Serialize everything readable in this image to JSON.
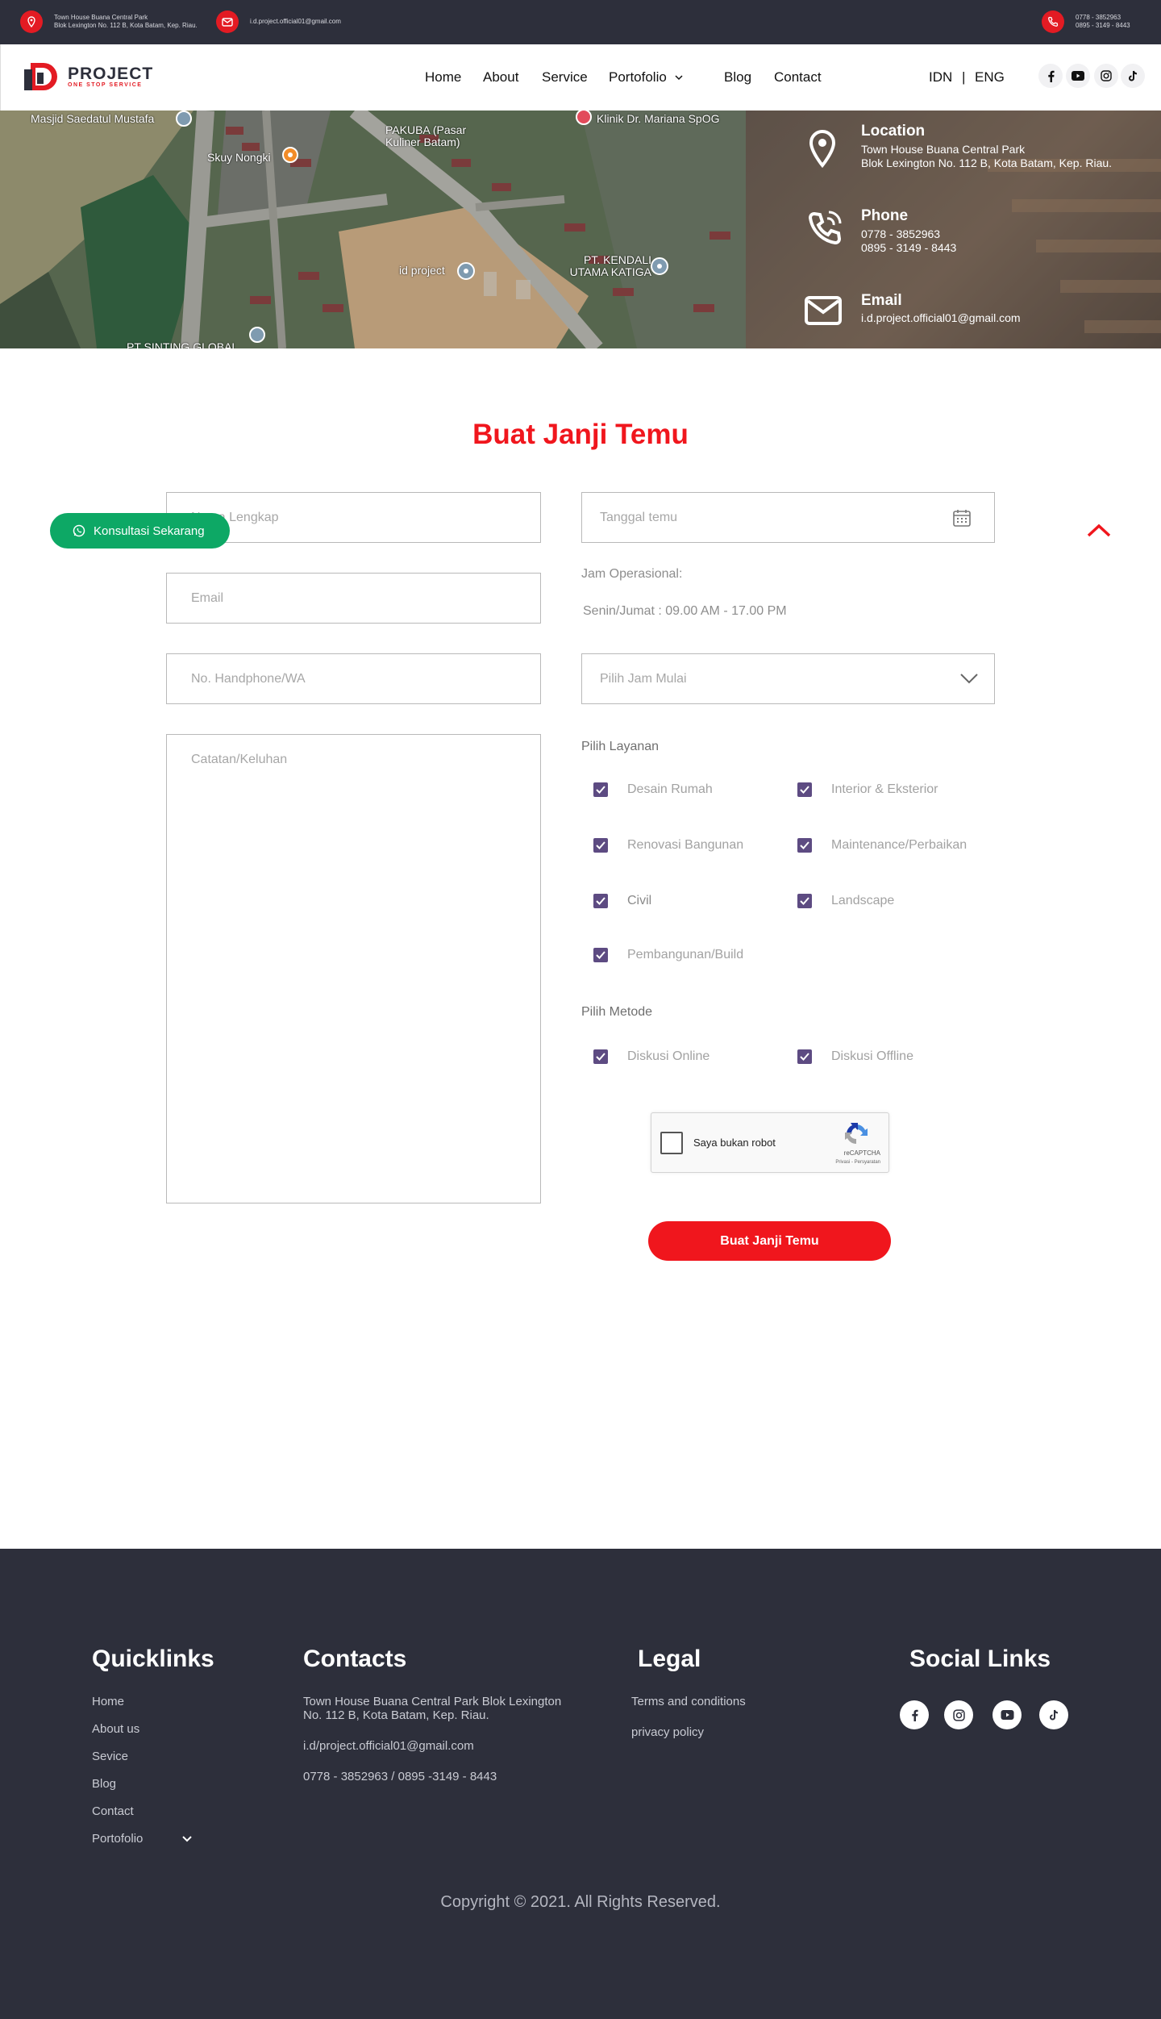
{
  "topbar": {
    "address_line1": "Town House Buana Central Park",
    "address_line2": "Blok Lexington No. 112 B, Kota Batam, Kep. Riau.",
    "email": "i.d.project.official01@gmail.com",
    "phone_line1": "0778 - 3852963",
    "phone_line2": "0895 - 3149 - 8443"
  },
  "brand": {
    "name": "PROJECT",
    "tagline": "ONE STOP SERVICE",
    "accent": "#e31b23",
    "dark": "#2d2f3b"
  },
  "nav": {
    "home": "Home",
    "about": "About",
    "service": "Service",
    "portofolio": "Portofolio",
    "blog": "Blog",
    "contact": "Contact"
  },
  "lang": {
    "idn": "IDN",
    "sep": "|",
    "eng": "ENG"
  },
  "map": {
    "labels": {
      "masjid": "Masjid Saedatul Mustafa",
      "skuy": "Skuy Nongki",
      "pakuba": "PAKUBA (Pasar Kuliner Batam)",
      "klinik": "Klinik Dr. Mariana SpOG",
      "idproject": "id project",
      "kendali": "PT. KENDALI UTAMA KATIGA",
      "sinting": "PT SINTING GLOBAL"
    }
  },
  "contact_info": {
    "location_title": "Location",
    "location_line1": "Town House Buana Central Park",
    "location_line2": "Blok Lexington No. 112 B, Kota Batam, Kep. Riau.",
    "phone_title": "Phone",
    "phone_line1": "0778 - 3852963",
    "phone_line2": "0895 - 3149 - 8443",
    "email_title": "Email",
    "email_value": "i.d.project.official01@gmail.com"
  },
  "form": {
    "title": "Buat Janji Temu",
    "name_placeholder": "Nama Lengkap",
    "email_placeholder": "Email",
    "phone_placeholder": "No. Handphone/WA",
    "notes_placeholder": "Catatan/Keluhan",
    "date_placeholder": "Tanggal temu",
    "hours_label": "Jam Operasional:",
    "hours_value": "Senin/Jumat : 09.00 AM - 17.00 PM",
    "time_select": "Pilih Jam Mulai",
    "services_label": "Pilih Layanan",
    "services": [
      "Desain Rumah",
      "Interior & Eksterior",
      "Renovasi Bangunan",
      "Maintenance/Perbaikan",
      "Civil",
      "Landscape",
      "Pembangunan/Build"
    ],
    "method_label": "Pilih Metode",
    "methods": [
      "Diskusi Online",
      "Diskusi Offline"
    ],
    "captcha_label": "Saya bukan robot",
    "captcha_brand": "reCAPTCHA",
    "captcha_links": "Privasi - Persyaratan",
    "submit": "Buat Janji Temu",
    "checkbox_color": "#5d4b82"
  },
  "whatsapp": {
    "label": "Konsultasi Sekarang",
    "color": "#0da865"
  },
  "footer": {
    "quicklinks_title": "Quicklinks",
    "quicklinks": [
      "Home",
      "About us",
      "Sevice",
      "Blog",
      "Contact",
      "Portofolio"
    ],
    "contacts_title": "Contacts",
    "contacts_address_line1": "Town House Buana Central Park Blok Lexington",
    "contacts_address_line2": "No. 112 B, Kota Batam, Kep. Riau.",
    "contacts_email": "i.d/project.official01@gmail.com",
    "contacts_phone": "0778 - 3852963 / 0895 -3149 - 8443",
    "legal_title": "Legal",
    "legal": [
      "Terms and conditions",
      "privacy policy"
    ],
    "social_title": "Social Links",
    "copyright": "Copyright © 2021. All Rights Reserved."
  }
}
